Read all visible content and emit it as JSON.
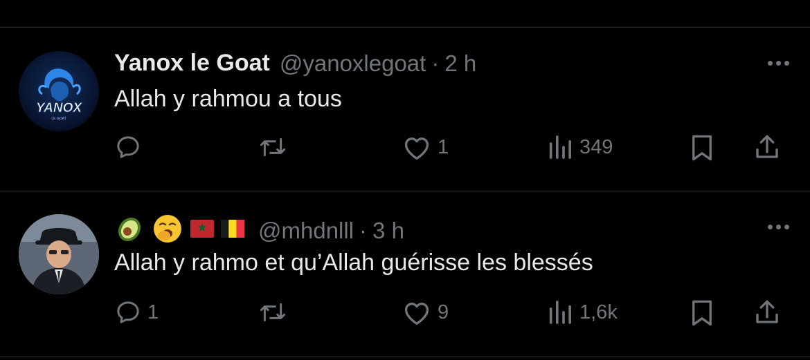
{
  "tweets": [
    {
      "display_name": "Yanox le Goat",
      "handle": "@yanoxlegoat",
      "separator": "·",
      "time": "2 h",
      "text": "Allah y rahmou a tous",
      "avatar_text": "YANOX",
      "avatar_subtext": "LE GOAT",
      "reply_count": "",
      "repost_count": "",
      "like_count": "1",
      "view_count": "349"
    },
    {
      "display_name_icons": [
        "avocado-emoji",
        "yawning-face-emoji",
        "morocco-flag",
        "belgium-flag"
      ],
      "handle": "@mhdnlll",
      "separator": "·",
      "time": "3 h",
      "text": "Allah y rahmo et qu’Allah guérisse les blessés",
      "reply_count": "1",
      "repost_count": "",
      "like_count": "9",
      "view_count": "1,6k"
    }
  ],
  "colors": {
    "background": "#000000",
    "primary_text": "#e7e9ea",
    "secondary_text": "#71767b",
    "divider": "#2f3336"
  }
}
